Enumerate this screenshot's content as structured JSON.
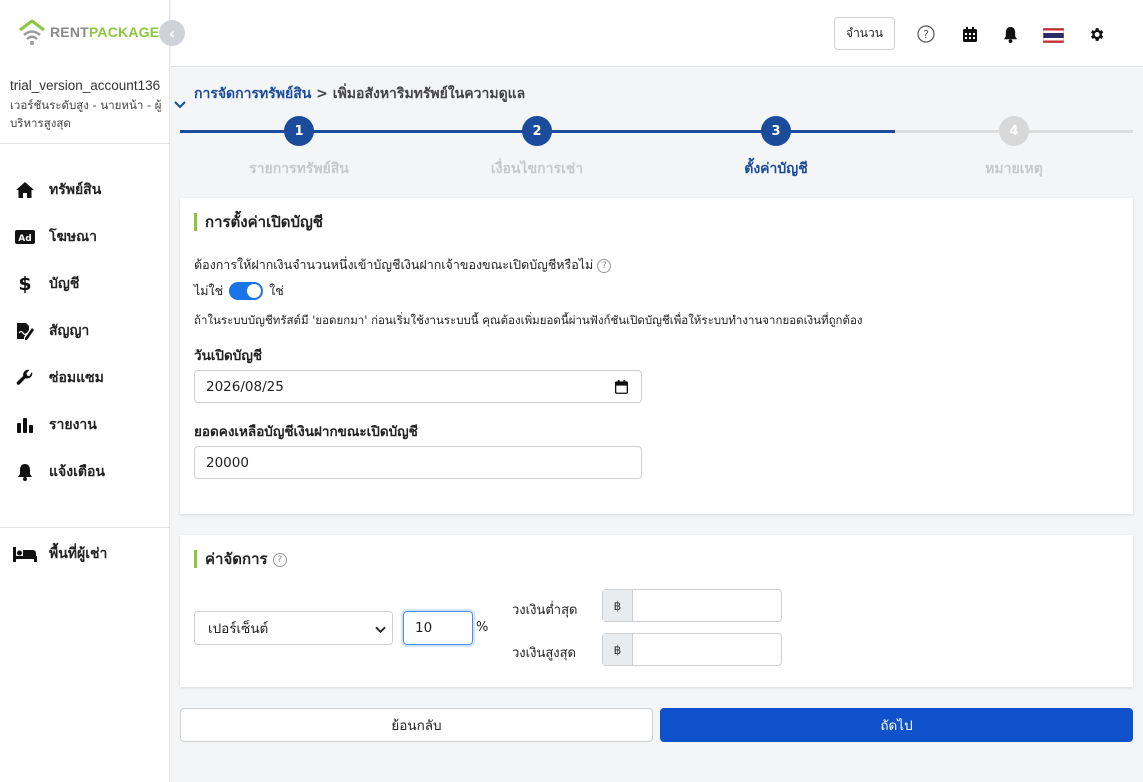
{
  "brand": {
    "rent": "RENT",
    "package": "PACKAGE",
    "accent": "#8cc63f",
    "primary": "#1b4c9c"
  },
  "account": {
    "name": "trial_version_account136",
    "plan": "เวอร์ชันระดับสูง - นายหน้า - ผู้บริหารสูงสุด"
  },
  "sidebar": {
    "items": [
      {
        "label": "ทรัพย์สิน",
        "icon": "home-icon"
      },
      {
        "label": "โฆษณา",
        "icon": "ad-icon"
      },
      {
        "label": "บัญชี",
        "icon": "dollar-icon"
      },
      {
        "label": "สัญญา",
        "icon": "contract-icon"
      },
      {
        "label": "ซ่อมแซม",
        "icon": "wrench-icon"
      },
      {
        "label": "รายงาน",
        "icon": "bar-chart-icon"
      },
      {
        "label": "แจ้งเตือน",
        "icon": "bell-icon"
      }
    ],
    "tenant_label": "พื้นที่ผู้เช่า"
  },
  "header": {
    "qty_label": "จำนวน"
  },
  "breadcrumb": {
    "root": "การจัดการทรัพย์สิน",
    "separator": " > ",
    "current": "เพิ่มอสังหาริมทรัพย์ในความดูแล"
  },
  "steps": [
    {
      "num": "1",
      "label": "รายการทรัพย์สิน",
      "state": "done"
    },
    {
      "num": "2",
      "label": "เงื่อนไขการเช่า",
      "state": "done"
    },
    {
      "num": "3",
      "label": "ตั้งค่าบัญชี",
      "state": "active"
    },
    {
      "num": "4",
      "label": "หมายเหตุ",
      "state": "pending"
    }
  ],
  "account_setup": {
    "title": "การตั้งค่าเปิดบัญชี",
    "question": "ต้องการให้ฝากเงินจำนวนหนึ่งเข้าบัญชีเงินฝากเจ้าของขณะเปิดบัญชีหรือไม่",
    "toggle_off": "ไม่ใช่",
    "toggle_on": "ใช่",
    "note": "ถ้าในระบบบัญชีทรัสต์มี 'ยอดยกมา' ก่อนเริ่มใช้งานระบบนี้ คุณต้องเพิ่มยอดนี้ผ่านฟังก์ชันเปิดบัญชีเพื่อให้ระบบทำงานจากยอดเงินที่ถูกต้อง",
    "open_date_label": "วันเปิดบัญชี",
    "open_date_value": "2026/08/25",
    "balance_label": "ยอดคงเหลือบัญชีเงินฝากขณะเปิดบัญชี",
    "balance_value": "20000"
  },
  "mgmt_fee": {
    "title": "ค่าจัดการ",
    "type_selected": "เปอร์เซ็นต์",
    "percent_value": "10",
    "percent_symbol": "%",
    "min_label": "วงเงินต่ำสุด",
    "max_label": "วงเงินสูงสุด",
    "currency": "฿",
    "min_value": "",
    "max_value": ""
  },
  "buttons": {
    "back": "ย้อนกลับ",
    "next": "ถัดไป"
  }
}
